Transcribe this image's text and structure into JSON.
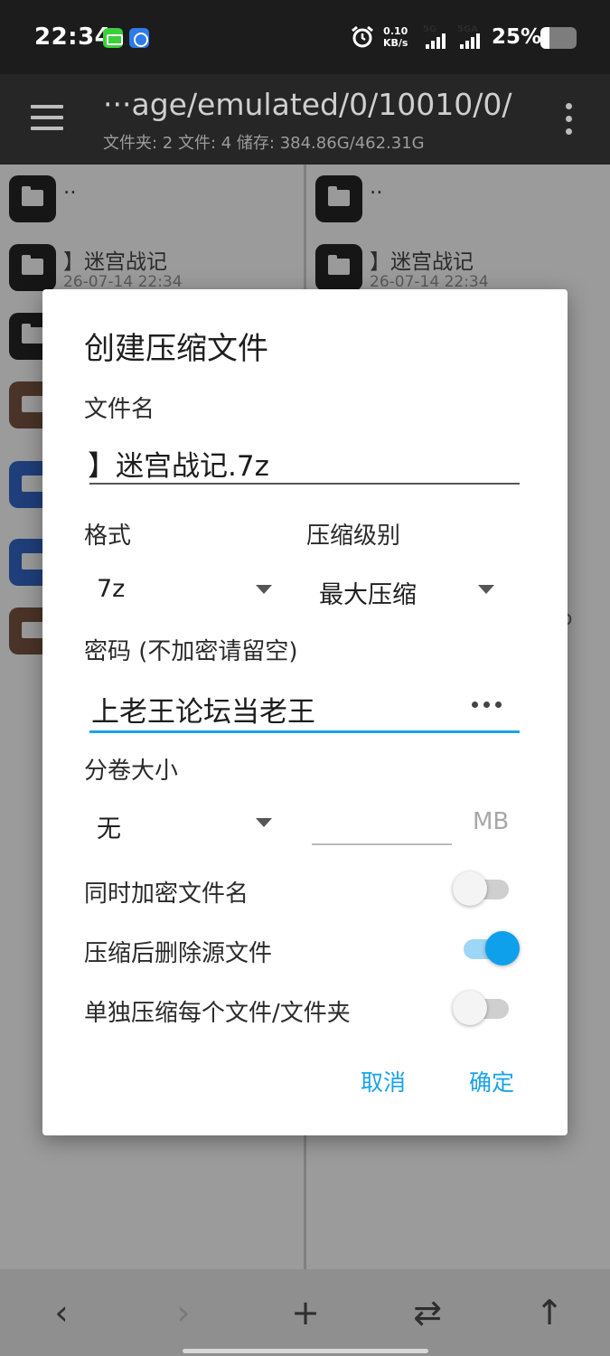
{
  "status_bar": {
    "time": "22:34",
    "net_speed_value": "0.10",
    "net_speed_unit": "KB/s",
    "signal1_label": "5G",
    "signal2_label": "5GA",
    "battery_text": "25%",
    "battery_level": 0.25
  },
  "app_bar": {
    "path": "···age/emulated/0/10010/0/",
    "subtitle": "文件夹: 2  文件: 4  储存: 384.86G/462.31G"
  },
  "left_pane": {
    "items": [
      {
        "name": "..",
        "date": ""
      },
      {
        "name": "】迷宫战记",
        "date": "26-07-14 22:34"
      }
    ]
  },
  "right_pane": {
    "items": [
      {
        "name": "..",
        "date": ""
      },
      {
        "name": "】迷宫战记",
        "date": "26-07-14 22:34"
      }
    ],
    "partial_text": "o"
  },
  "dialog": {
    "title": "创建压缩文件",
    "filename_label": "文件名",
    "filename_value": "】迷宫战记.7z",
    "format_label": "格式",
    "format_value": "7z",
    "level_label": "压缩级别",
    "level_value": "最大压缩",
    "password_label": "密码 (不加密请留空)",
    "password_value": "上老王论坛当老王",
    "split_label": "分卷大小",
    "split_value": "无",
    "split_size_value": "",
    "split_unit": "MB",
    "options": [
      {
        "label": "同时加密文件名",
        "enabled": false
      },
      {
        "label": "压缩后删除源文件",
        "enabled": true
      },
      {
        "label": "单独压缩每个文件/文件夹",
        "enabled": false
      }
    ],
    "cancel_label": "取消",
    "ok_label": "确定",
    "accent_color": "#1aa3e8"
  },
  "bottom_nav": {
    "back": "‹",
    "forward": "›",
    "add": "+",
    "swap": "⇄",
    "up": "↑"
  }
}
